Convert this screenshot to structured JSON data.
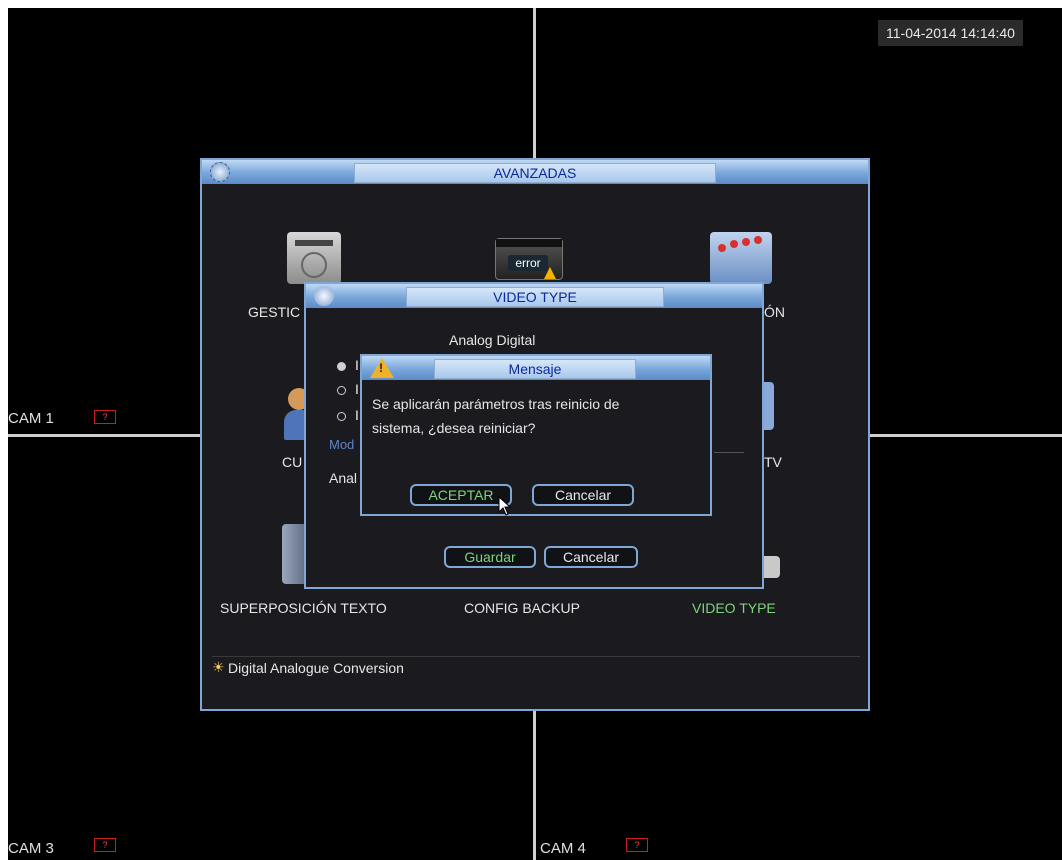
{
  "datetime": "11-04-2014 14:14:40",
  "cameras": {
    "cam1": "CAM 1",
    "cam3": "CAM 3",
    "cam4": "CAM 4"
  },
  "no_signal_glyph": "?",
  "advanced_window": {
    "title": "AVANZADAS",
    "items": {
      "gestion_partial": "GESTIC",
      "row1_right_partial": "ÓN",
      "cuentas_partial": "CU",
      "tv_partial": "TV",
      "superposicion": "SUPERPOSICIÓN TEXTO",
      "config_backup": "CONFIG BACKUP",
      "video_type": "VIDEO TYPE"
    },
    "error_icon_text": "error",
    "hint": "Digital Analogue Conversion"
  },
  "video_type_window": {
    "title": "VIDEO TYPE",
    "col_headers": "Analog  Digital",
    "row_initials": [
      "I",
      "I",
      "I"
    ],
    "mode_partial": "Mod",
    "analog_partial": "Anal",
    "save_label": "Guardar",
    "cancel_label": "Cancelar"
  },
  "message_dialog": {
    "title": "Mensaje",
    "warning_glyph": "!",
    "line1": "Se aplicarán parámetros tras reinicio de",
    "line2": "sistema, ¿desea reiniciar?",
    "accept_label": "ACEPTAR",
    "cancel_label": "Cancelar"
  },
  "colors": {
    "accent": "#7fa7d6",
    "highlight": "#7ed37e",
    "titlebar": "#7aa6da"
  }
}
